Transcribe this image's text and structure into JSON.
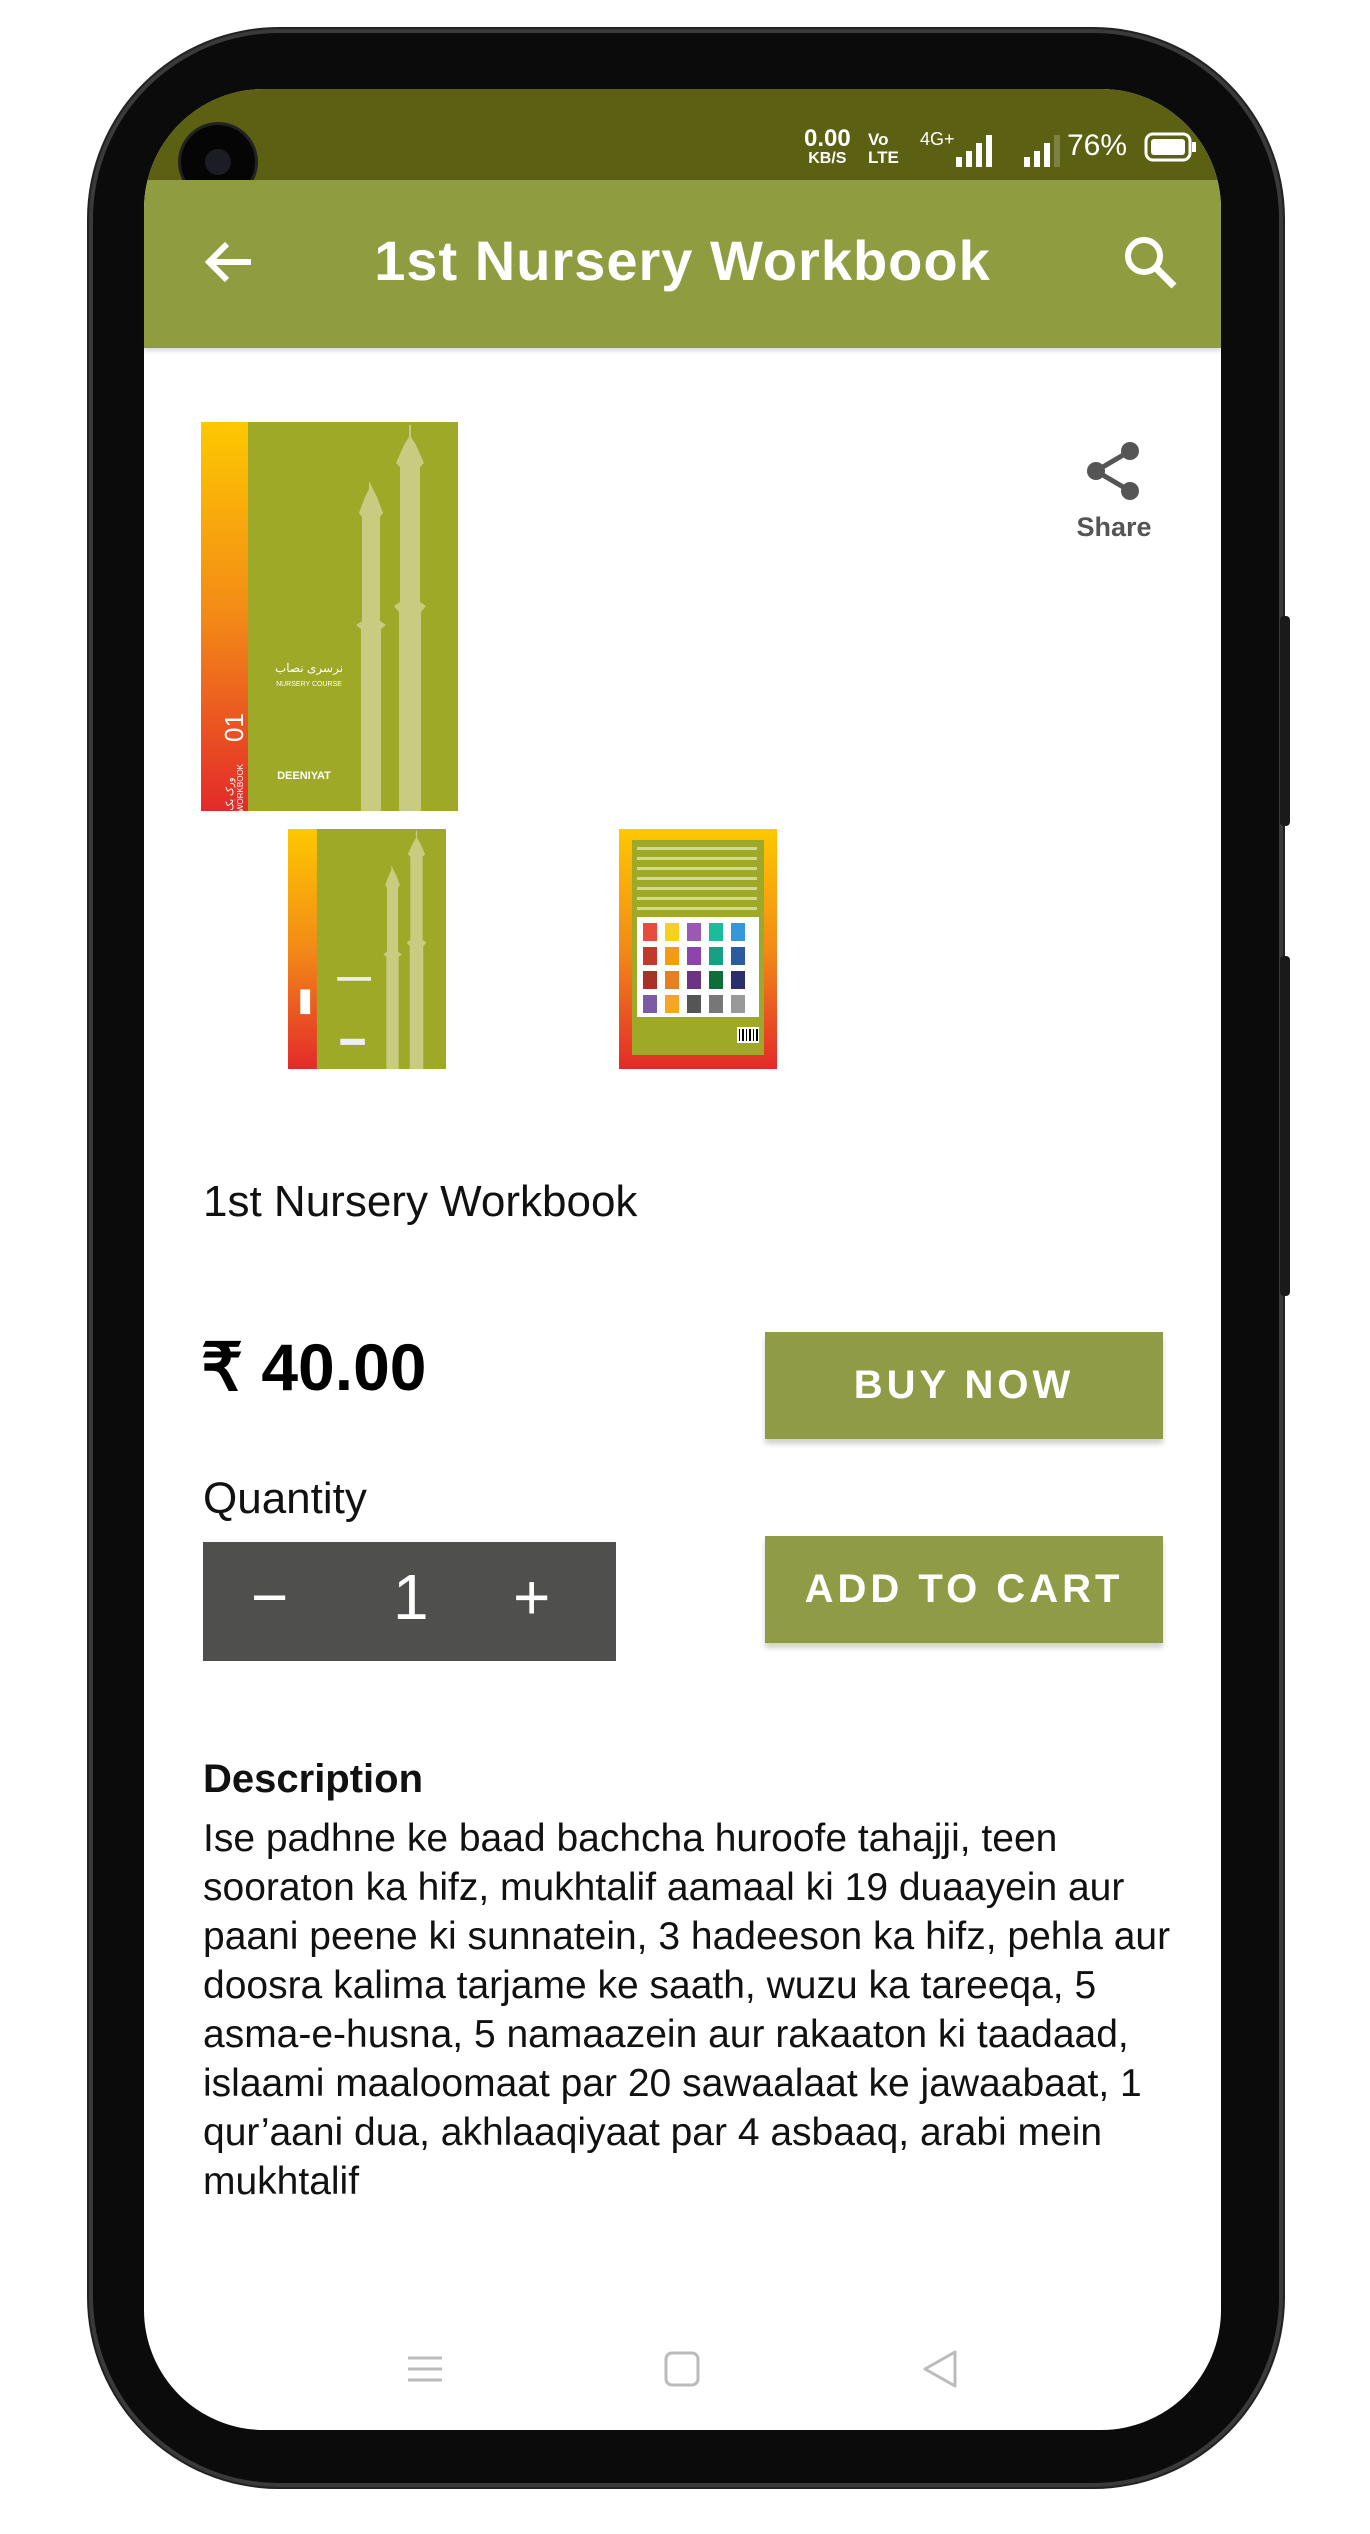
{
  "status_bar": {
    "net_speed": "0.00",
    "net_unit": "KB/S",
    "volte_top": "Vo",
    "volte_bottom": "LTE",
    "network": "4G+",
    "battery": "76%"
  },
  "app_bar": {
    "title": "1st Nursery Workbook",
    "back_icon": "arrow-left-icon",
    "search_icon": "search-icon"
  },
  "cover": {
    "urdu_title": "نرسری نصاب",
    "course": "NURSERY COURSE",
    "number": "01",
    "workbook": "WORKBOOK",
    "urdu_workbook": "ورک بک",
    "brand": "DEENIYAT"
  },
  "share": {
    "label": "Share",
    "icon": "share-icon"
  },
  "product": {
    "name": "1st Nursery Workbook",
    "price": "₹ 40.00",
    "buy_now": "BUY NOW",
    "add_to_cart": "ADD TO CART",
    "quantity_label": "Quantity",
    "quantity": "1",
    "minus": "−",
    "plus": "+"
  },
  "description": {
    "heading": "Description",
    "text": "Ise padhne ke baad bachcha huroofe tahajji, teen sooraton ka hifz, mukhtalif aamaal ki 19 duaayein aur paani peene ki sunnatein, 3 hadeeson ka hifz, pehla aur doosra kalima tarjame ke saath, wuzu ka tareeqa, 5 asma-e-husna, 5 namaazein aur rakaaton ki taadaad, islaami maaloomaat par 20 sawaalaat ke jawaabaat, 1 qur’aani dua, akhlaaqiyaat par 4 asbaaq, arabi mein mukhtalif"
  },
  "colors": {
    "status_bar": "#5b6012",
    "app_bar": "#8f9c40",
    "button": "#8f9c45",
    "stepper": "#4f4f4d",
    "cover_green": "#9eaa27"
  }
}
